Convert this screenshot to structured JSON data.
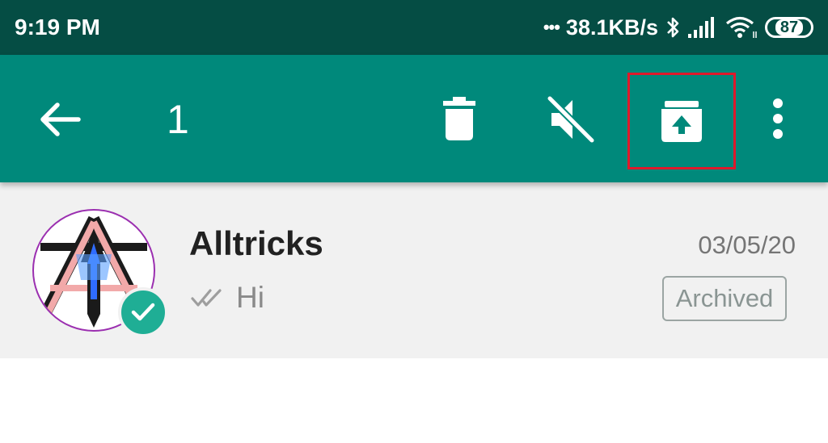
{
  "status_bar": {
    "time": "9:19 PM",
    "dots": "•••",
    "network_speed": "38.1KB/s",
    "battery_level": "87",
    "icons": [
      "bluetooth-icon",
      "signal-icon",
      "wifi-icon",
      "battery-icon"
    ]
  },
  "toolbar": {
    "selected_count": "1",
    "actions": [
      "back-arrow-icon",
      "delete-icon",
      "mute-icon",
      "unarchive-icon",
      "more-options-icon"
    ],
    "highlight_color": "#e0192b",
    "background_color": "#00897b"
  },
  "chat": {
    "name": "Alltricks",
    "last_message": "Hi",
    "date": "03/05/20",
    "status_label": "Archived",
    "selected": true,
    "accent_color": "#1fae95"
  }
}
